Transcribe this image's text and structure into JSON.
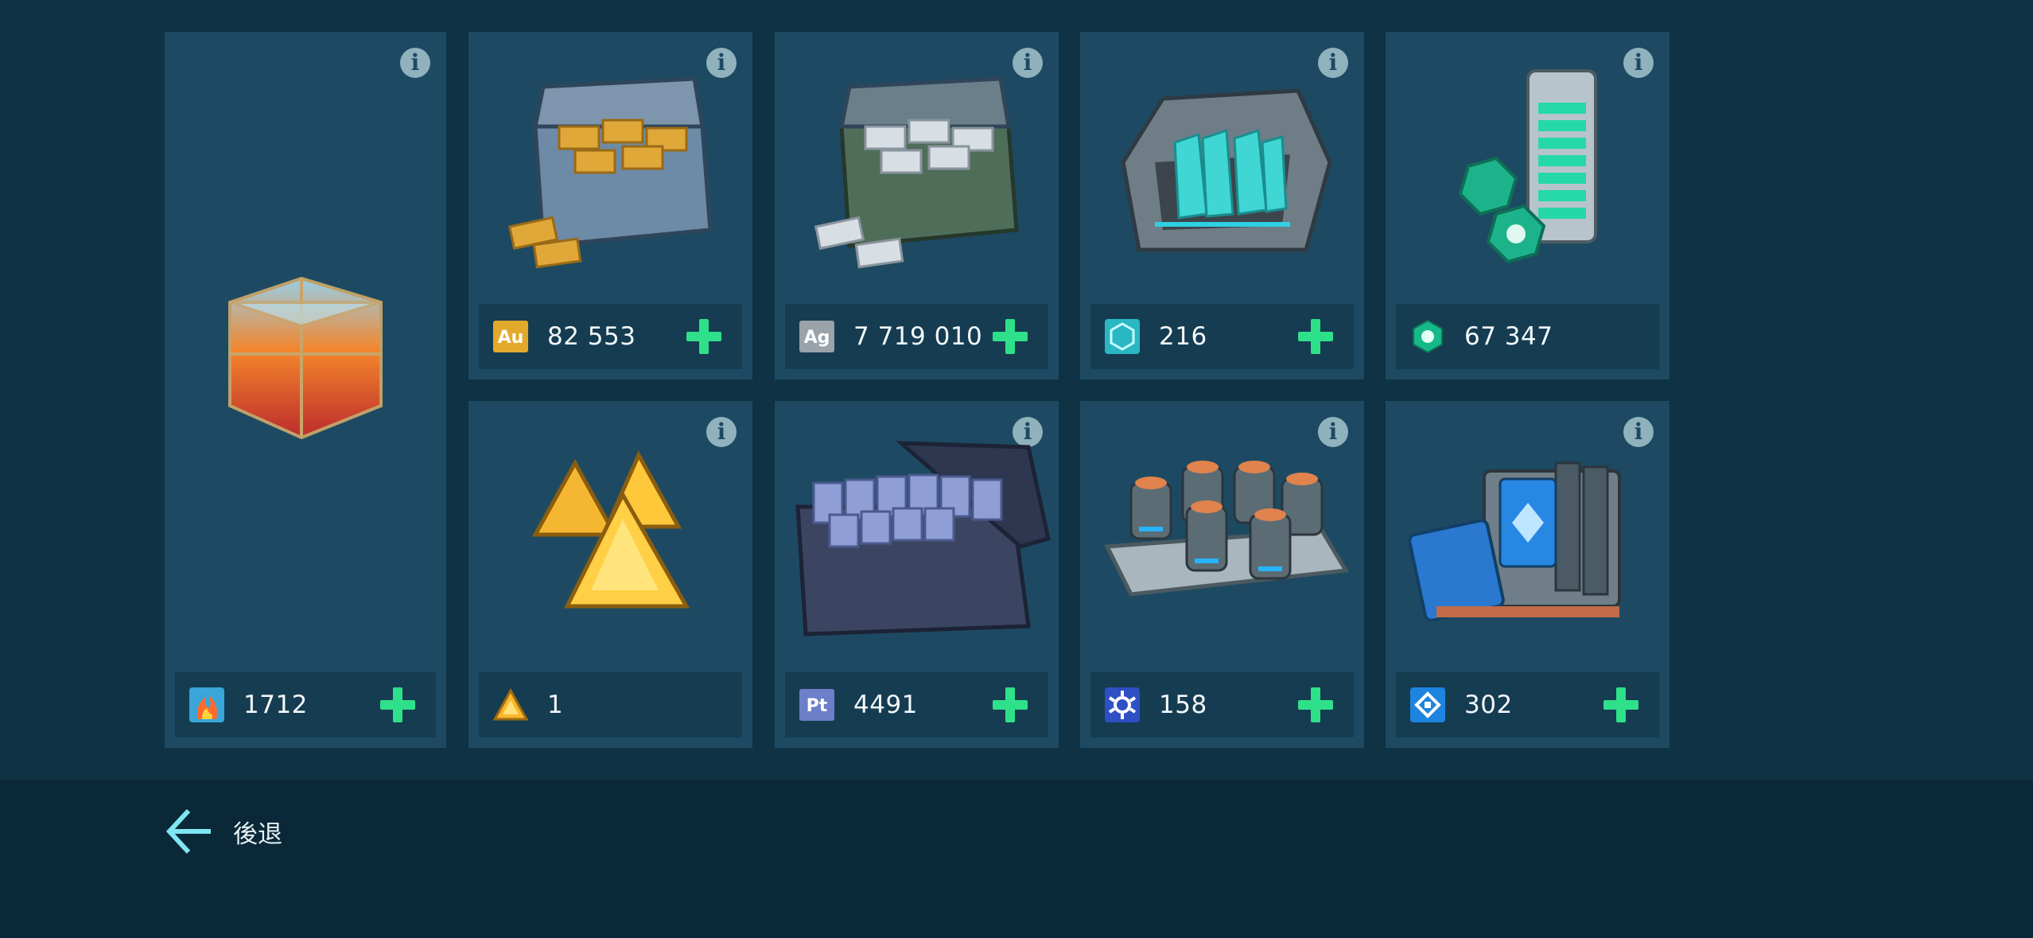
{
  "resources": [
    {
      "id": "flame-cubes",
      "value": "1712",
      "icon": "flame-cube-icon",
      "has_plus": true
    },
    {
      "id": "gold",
      "value": "82 553",
      "icon": "gold-au-icon",
      "icon_text": "Au",
      "has_plus": true
    },
    {
      "id": "silver",
      "value": "7 719 010",
      "icon": "silver-ag-icon",
      "icon_text": "Ag",
      "has_plus": true
    },
    {
      "id": "hex-crystals",
      "value": "216",
      "icon": "hex-crystal-icon",
      "has_plus": true
    },
    {
      "id": "green-tokens",
      "value": "67 347",
      "icon": "green-token-icon",
      "has_plus": false
    },
    {
      "id": "gold-triangles",
      "value": "1",
      "icon": "gold-triangle-icon",
      "has_plus": false
    },
    {
      "id": "platinum",
      "value": "4491",
      "icon": "platinum-pt-icon",
      "icon_text": "Pt",
      "has_plus": true
    },
    {
      "id": "modules",
      "value": "158",
      "icon": "module-gear-icon",
      "has_plus": true
    },
    {
      "id": "blueprints",
      "value": "302",
      "icon": "blueprint-chip-icon",
      "has_plus": true
    }
  ],
  "info_label": "i",
  "navigation": {
    "back_label": "後退",
    "back_icon": "arrow-left-icon"
  },
  "colors": {
    "background": "#0f3244",
    "bottom_bar": "#0b2838",
    "card": "#1d4a62",
    "resource_bar": "#163c51",
    "plus": "#2fe08a",
    "info": "#8fb2bd"
  }
}
